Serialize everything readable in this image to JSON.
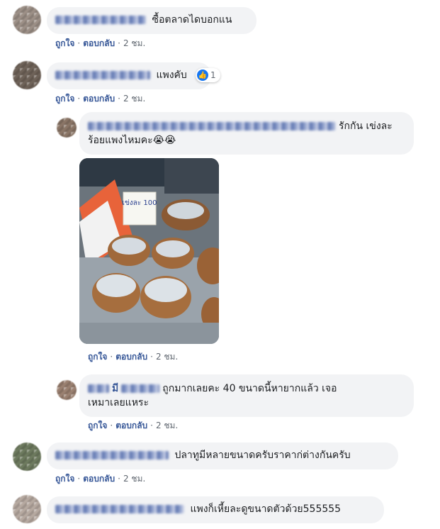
{
  "comments": [
    {
      "text": "ซื้อตลาดไดบอกแน",
      "actions": {
        "like": "ถูกใจ",
        "reply": "ตอบกลับ",
        "time": "2 ชม."
      }
    },
    {
      "text": "แพงคับ",
      "reaction_count": "1",
      "actions": {
        "like": "ถูกใจ",
        "reply": "ตอบกลับ",
        "time": "2 ชม."
      }
    },
    {
      "text_tail": "รักกัน เข่งละ",
      "text_line2": "ร้อยแพงไหมคะ",
      "emoji": "😭😭",
      "photo_sign": "เข่งละ 100",
      "actions": {
        "like": "ถูกใจ",
        "reply": "ตอบกลับ",
        "time": "2 ชม."
      }
    },
    {
      "name_visible": "มี",
      "text": "ถูกมากเลยคะ 40 ขนาดนี้หายากแล้ว เจอ",
      "text_line2": "เหมาเลยแหระ",
      "actions": {
        "like": "ถูกใจ",
        "reply": "ตอบกลับ",
        "time": "2 ชม."
      }
    },
    {
      "text": "ปลาทูมีหลายขนาดครับราคาก่ต่างกันครับ",
      "actions": {
        "like": "ถูกใจ",
        "reply": "ตอบกลับ",
        "time": "2 ชม."
      }
    },
    {
      "text": "แพงก็เหี้ยละดูขนาดตัวด้วย555555"
    }
  ],
  "icons": {
    "reaction": "like-icon"
  },
  "colors": {
    "bubble": "#f2f3f5",
    "link": "#385898",
    "like_blue": "#1877f2"
  }
}
